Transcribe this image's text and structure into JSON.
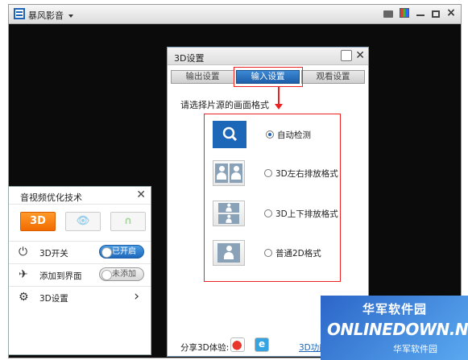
{
  "player": {
    "app_title": "暴风影音",
    "icons": [
      "app-logo-icon",
      "title-dropdown-icon",
      "chat-icon",
      "skin-icon",
      "minimize-icon",
      "maximize-icon",
      "close-icon"
    ]
  },
  "dialog": {
    "title": "3D设置",
    "close": "✕",
    "tabs": [
      {
        "label": "输出设置",
        "active": false
      },
      {
        "label": "输入设置",
        "active": true
      },
      {
        "label": "观看设置",
        "active": false
      }
    ],
    "prompt": "请选择片源的画面格式",
    "options": [
      {
        "label": "自动检测",
        "selected": true,
        "icon": "magnifier-icon"
      },
      {
        "label": "3D左右排放格式",
        "selected": false,
        "icon": "side-by-side-icon"
      },
      {
        "label": "3D上下排放格式",
        "selected": false,
        "icon": "top-bottom-icon"
      },
      {
        "label": "普通2D格式",
        "selected": false,
        "icon": "2d-person-icon"
      }
    ],
    "share_label": "分享3D体验:",
    "share_icons": [
      "weibo-icon",
      "qzone-icon"
    ],
    "func_link": "3D功能"
  },
  "panel": {
    "title": "音视频优化技术",
    "close": "✕",
    "modes": [
      {
        "label": "3D",
        "active": true,
        "icon": "3d-mode-icon"
      },
      {
        "label": "👁",
        "active": false,
        "icon": "eye-mode-icon"
      },
      {
        "label": "∩",
        "active": false,
        "icon": "headphone-mode-icon"
      }
    ],
    "rows": [
      {
        "icon": "power-icon",
        "glyph": "⏻",
        "label": "3D开关",
        "toggle": "已开启",
        "toggle_on": true
      },
      {
        "icon": "pin-icon",
        "glyph": "✈",
        "label": "添加到界面",
        "toggle": "未添加",
        "toggle_on": false
      },
      {
        "icon": "gear-icon",
        "glyph": "⚙",
        "label": "3D设置",
        "chevron": "›"
      }
    ]
  },
  "watermark": {
    "cn": "华军软件园",
    "en": "ONLINEDOWN.NET",
    "cn_small": "华军软件园"
  },
  "colors": {
    "accent_blue": "#1c67b8",
    "highlight_red": "#e22222",
    "mode_orange": "#f26b00",
    "player_bg": "#0b0b0b"
  }
}
